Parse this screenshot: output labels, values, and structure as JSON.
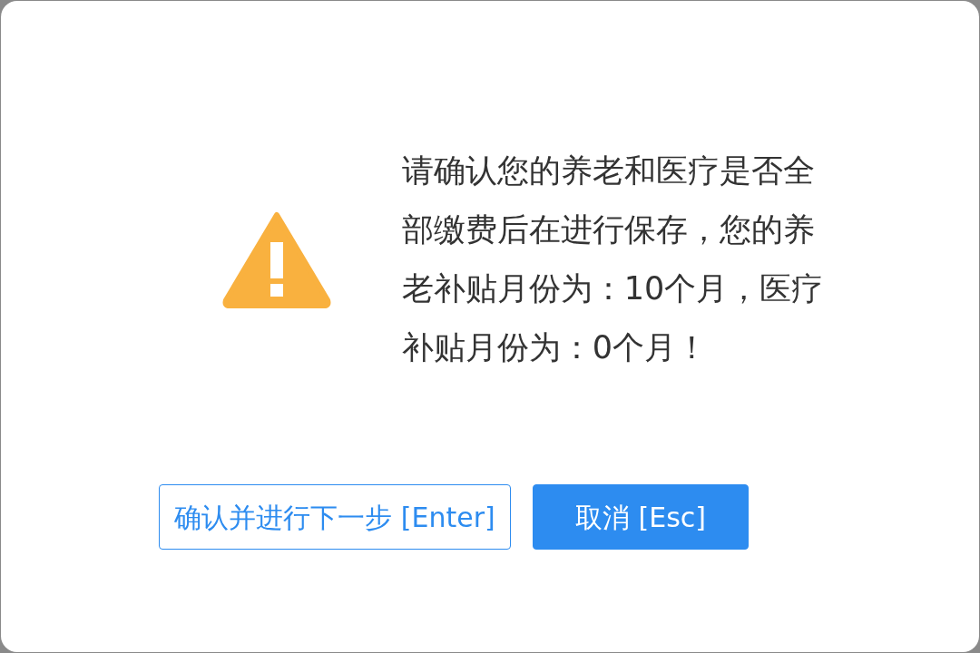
{
  "dialog": {
    "message": "请确认您的养老和医疗是否全部缴费后在进行保存，您的养老补贴月份为：10个月，医疗补贴月份为：0个月！",
    "buttons": [
      {
        "label": "确认并进行下一步 [Enter]",
        "kind": "outline"
      },
      {
        "label": "取消 [Esc]",
        "kind": "primary"
      }
    ]
  }
}
